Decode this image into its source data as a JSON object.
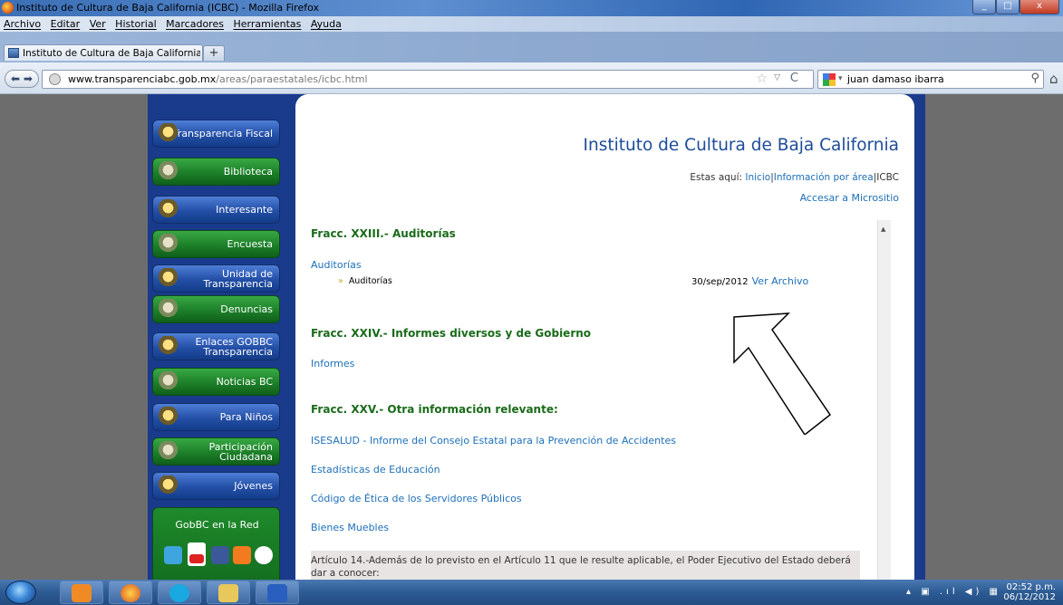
{
  "window": {
    "title": "Instituto de Cultura de Baja California (ICBC) - Mozilla Firefox",
    "controls": [
      "_",
      "□",
      "x"
    ]
  },
  "menu": [
    "Archivo",
    "Editar",
    "Ver",
    "Historial",
    "Marcadores",
    "Herramientas",
    "Ayuda"
  ],
  "tab": {
    "label": "Instituto de Cultura de Baja California (I...",
    "new_tab": "+"
  },
  "nav": {
    "url_domain": "www.transparenciabc.gob.mx",
    "url_path": "/areas/paraestatales/icbc.html",
    "search_value": "juan damaso ibarra"
  },
  "sidebar": [
    {
      "label": "Transparencia Fiscal",
      "color": "blue"
    },
    {
      "label": "Biblioteca",
      "color": "green"
    },
    {
      "label": "Interesante",
      "color": "blue"
    },
    {
      "label": "Encuesta",
      "color": "green"
    },
    {
      "label": "Unidad de Transparencia",
      "color": "blue"
    },
    {
      "label": "Denuncias",
      "color": "green"
    },
    {
      "label": "Enlaces GOBBC Transparencia",
      "color": "blue"
    },
    {
      "label": "Noticias BC",
      "color": "green"
    },
    {
      "label": "Para Niños",
      "color": "blue"
    },
    {
      "label": "Participación Ciudadana",
      "color": "green"
    },
    {
      "label": "Jóvenes",
      "color": "blue"
    }
  ],
  "social": {
    "title": "GobBC en la Red"
  },
  "content": {
    "institute_title": "Instituto de Cultura de Baja California",
    "breadcrumb_prefix": "Estas aquí:",
    "breadcrumb_inicio": "Inicio",
    "breadcrumb_area": "Información por área",
    "breadcrumb_current": "ICBC",
    "microsite": "Accesar a Micrositio",
    "sections": [
      {
        "title": "Fracc. XXIII.- Auditorías"
      },
      {
        "title": "Fracc. XXIV.- Informes diversos y de Gobierno"
      },
      {
        "title": "Fracc. XXV.- Otra información relevante:"
      }
    ],
    "auditorias_link": "Auditorías",
    "auditorias_item": "Auditorías",
    "auditorias_date": "30/sep/2012",
    "auditorias_file": "Ver Archivo",
    "informes_link": "Informes",
    "links": [
      "ISESALUD - Informe del Consejo Estatal para la Prevención de Accidentes",
      "Estadísticas de Educación",
      "Código de Ética de los Servidores Públicos",
      "Bienes Muebles"
    ],
    "article_text": "Artículo 14.-Además de lo previsto en el Artículo 11 que le resulte aplicable, el Poder Ejecutivo del Estado deberá dar a conocer:"
  },
  "taskbar": {
    "time": "02:52 p.m.",
    "date": "06/12/2012"
  }
}
